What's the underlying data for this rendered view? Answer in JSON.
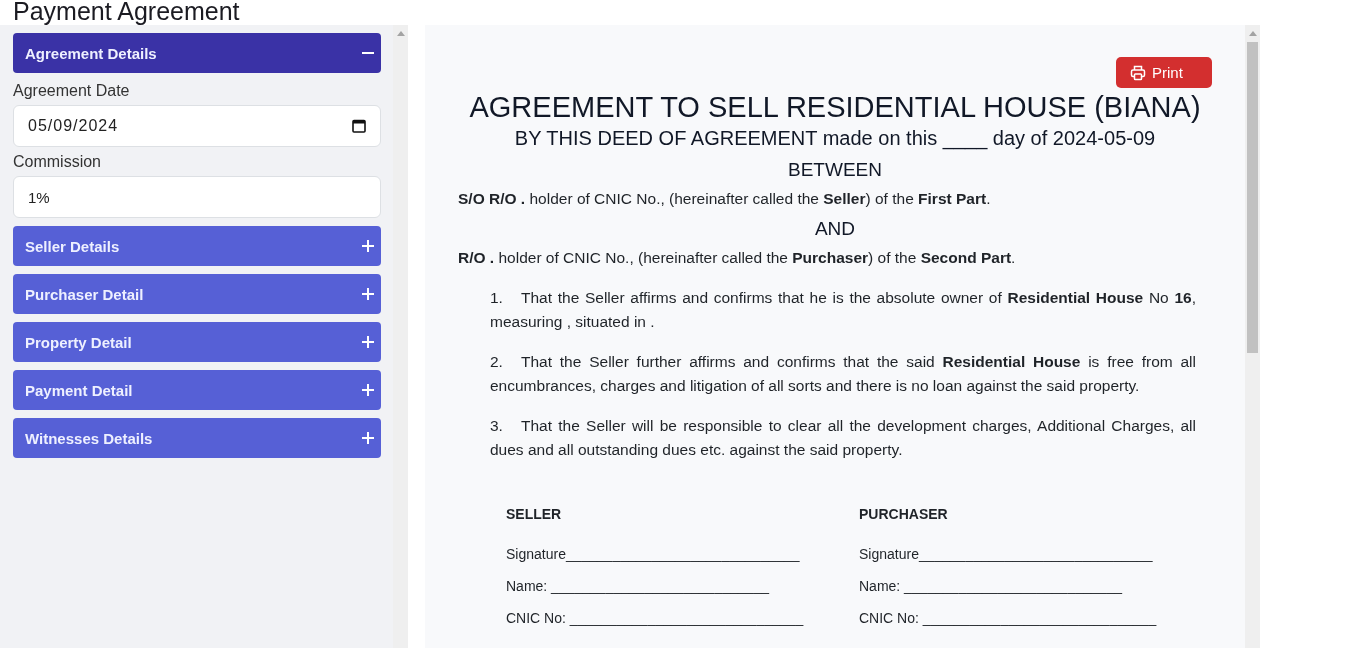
{
  "page": {
    "title": "Payment Agreement"
  },
  "sidebar": {
    "sections": [
      {
        "title": "Agreement Details",
        "expanded": true,
        "fields": [
          {
            "label": "Agreement Date",
            "kind": "date",
            "value": "05/09/2024"
          },
          {
            "label": "Commission",
            "kind": "text",
            "value": "1%"
          }
        ]
      },
      {
        "title": "Seller Details",
        "expanded": false
      },
      {
        "title": "Purchaser Detail",
        "expanded": false
      },
      {
        "title": "Property Detail",
        "expanded": false
      },
      {
        "title": "Payment Detail",
        "expanded": false
      },
      {
        "title": "Witnesses Details",
        "expanded": false
      }
    ]
  },
  "document": {
    "print_button": "Print",
    "title": "AGREEMENT TO SELL RESIDENTIAL HOUSE (BIANA)",
    "subtitle": "BY THIS DEED OF AGREEMENT made on this ____ day of 2024-05-09",
    "parties": [
      {
        "kind": "heading",
        "text": "BETWEEN"
      },
      {
        "kind": "paragraph",
        "text": "**S/O R/O .** holder of CNIC No., (hereinafter called the **Seller**) of the **First Part**."
      },
      {
        "kind": "heading",
        "text": "AND"
      },
      {
        "kind": "paragraph",
        "text": "**R/O .** holder of CNIC No., (hereinafter called the **Purchaser**) of the **Second Part**."
      }
    ],
    "clauses": [
      {
        "number": "1.",
        "text": "That the Seller affirms and confirms that he is the absolute owner of **Residential House** No **16**, measuring , situated in ."
      },
      {
        "number": "2.",
        "text": "That the Seller further affirms and confirms that the said **Residential House** is free from all encumbrances, charges and litigation of all sorts and there is no loan against the said property."
      },
      {
        "number": "3.",
        "text": "That the Seller will be responsible to clear all the development charges, Additional Charges, all dues and all outstanding dues etc. against the said property."
      }
    ],
    "signatures": [
      {
        "heading": "SELLER",
        "lines": [
          "Signature______________________________",
          "Name: ____________________________",
          "CNIC No: ______________________________"
        ]
      },
      {
        "heading": "PURCHASER",
        "lines": [
          "Signature______________________________",
          "Name: ____________________________",
          "CNIC No: ______________________________"
        ]
      }
    ]
  }
}
